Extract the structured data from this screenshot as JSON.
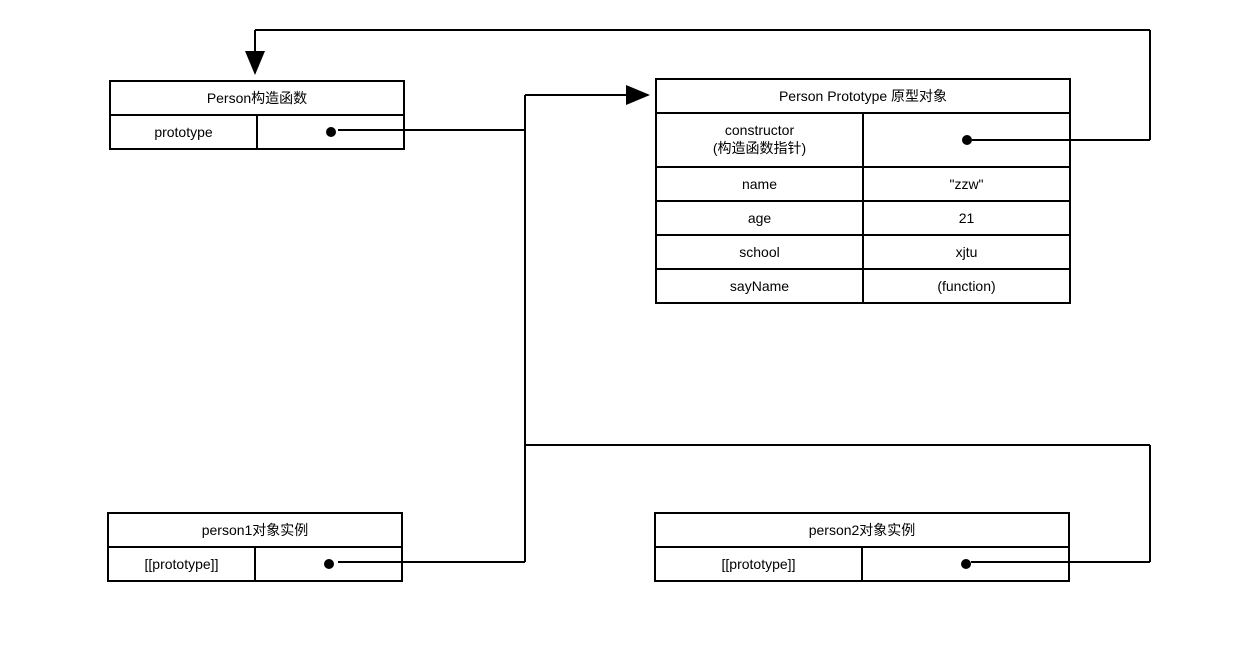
{
  "constructorBox": {
    "title": "Person构造函数",
    "row": {
      "left": "prototype"
    }
  },
  "prototypeBox": {
    "title": "Person Prototype 原型对象",
    "rows": [
      {
        "left_line1": "constructor",
        "left_line2": "(构造函数指针)",
        "rightIsDot": true
      },
      {
        "left": "name",
        "right": "\"zzw\""
      },
      {
        "left": "age",
        "right": "21"
      },
      {
        "left": "school",
        "right": "xjtu"
      },
      {
        "left": "sayName",
        "right": "(function)"
      }
    ]
  },
  "person1Box": {
    "title": "person1对象实例",
    "row": {
      "left": "[[prototype]]"
    }
  },
  "person2Box": {
    "title": "person2对象实例",
    "row": {
      "left": "[[prototype]]"
    }
  }
}
